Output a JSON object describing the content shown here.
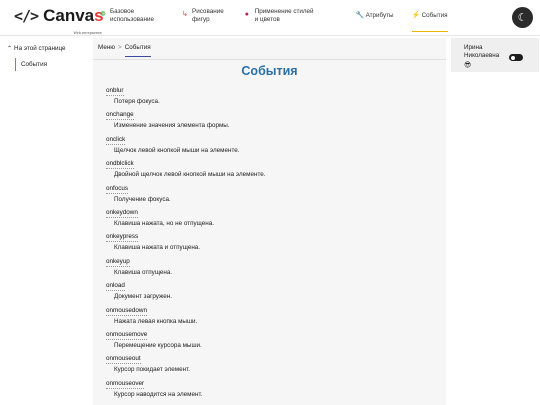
{
  "logo": {
    "brackets": "</>",
    "word_main": "Canva",
    "word_accent": "s",
    "subtitle": "Web интерактив"
  },
  "nav": [
    {
      "icon": "❁",
      "line1": "Базовое",
      "line2": "использование",
      "color": "#4caf50"
    },
    {
      "icon": "↳",
      "line1": "Рисование",
      "line2": "фигур",
      "color": "#e53935"
    },
    {
      "icon": "●",
      "line1": "Применение стилей",
      "line2": "и цветов",
      "color": "#c2185b"
    },
    {
      "icon": "🔧",
      "line1": "Атрибуты",
      "line2": "",
      "color": "#1e88e5"
    },
    {
      "icon": "⚡",
      "line1": "События",
      "line2": "",
      "color": "#f0b400",
      "active": true
    }
  ],
  "theme_toggle_icon": "moon-icon",
  "toc": {
    "title": "На этой странице",
    "items": [
      "События"
    ]
  },
  "breadcrumb": {
    "root": "Меню",
    "separator": ">",
    "current": "События"
  },
  "page_title": "События",
  "events": [
    {
      "name": "onblur",
      "desc": "Потеря фокуса."
    },
    {
      "name": "onchange",
      "desc": "Изменение значения элемента формы."
    },
    {
      "name": "onclick",
      "desc": "Щелчок левой кнопкой мыши на элементе."
    },
    {
      "name": "ondblclick",
      "desc": "Двойной щелчок левой кнопкой мыши на элементе."
    },
    {
      "name": "onfocus",
      "desc": "Получение фокуса."
    },
    {
      "name": "onkeydown",
      "desc": "Клавиша нажата, но не отпущена."
    },
    {
      "name": "onkeypress",
      "desc": "Клавиша нажата и отпущена."
    },
    {
      "name": "onkeyup",
      "desc": "Клавиша отпущена."
    },
    {
      "name": "onload",
      "desc": "Документ загружен."
    },
    {
      "name": "onmousedown",
      "desc": "Нажата левая кнопка мыши."
    },
    {
      "name": "onmousemove",
      "desc": "Перемещение курсора мыши."
    },
    {
      "name": "onmouseout",
      "desc": "Курсор покидает элемент."
    },
    {
      "name": "onmouseover",
      "desc": "Курсор наводится на элемент."
    }
  ],
  "user": {
    "name": "Ирина Николаевна",
    "icon": "😎"
  }
}
